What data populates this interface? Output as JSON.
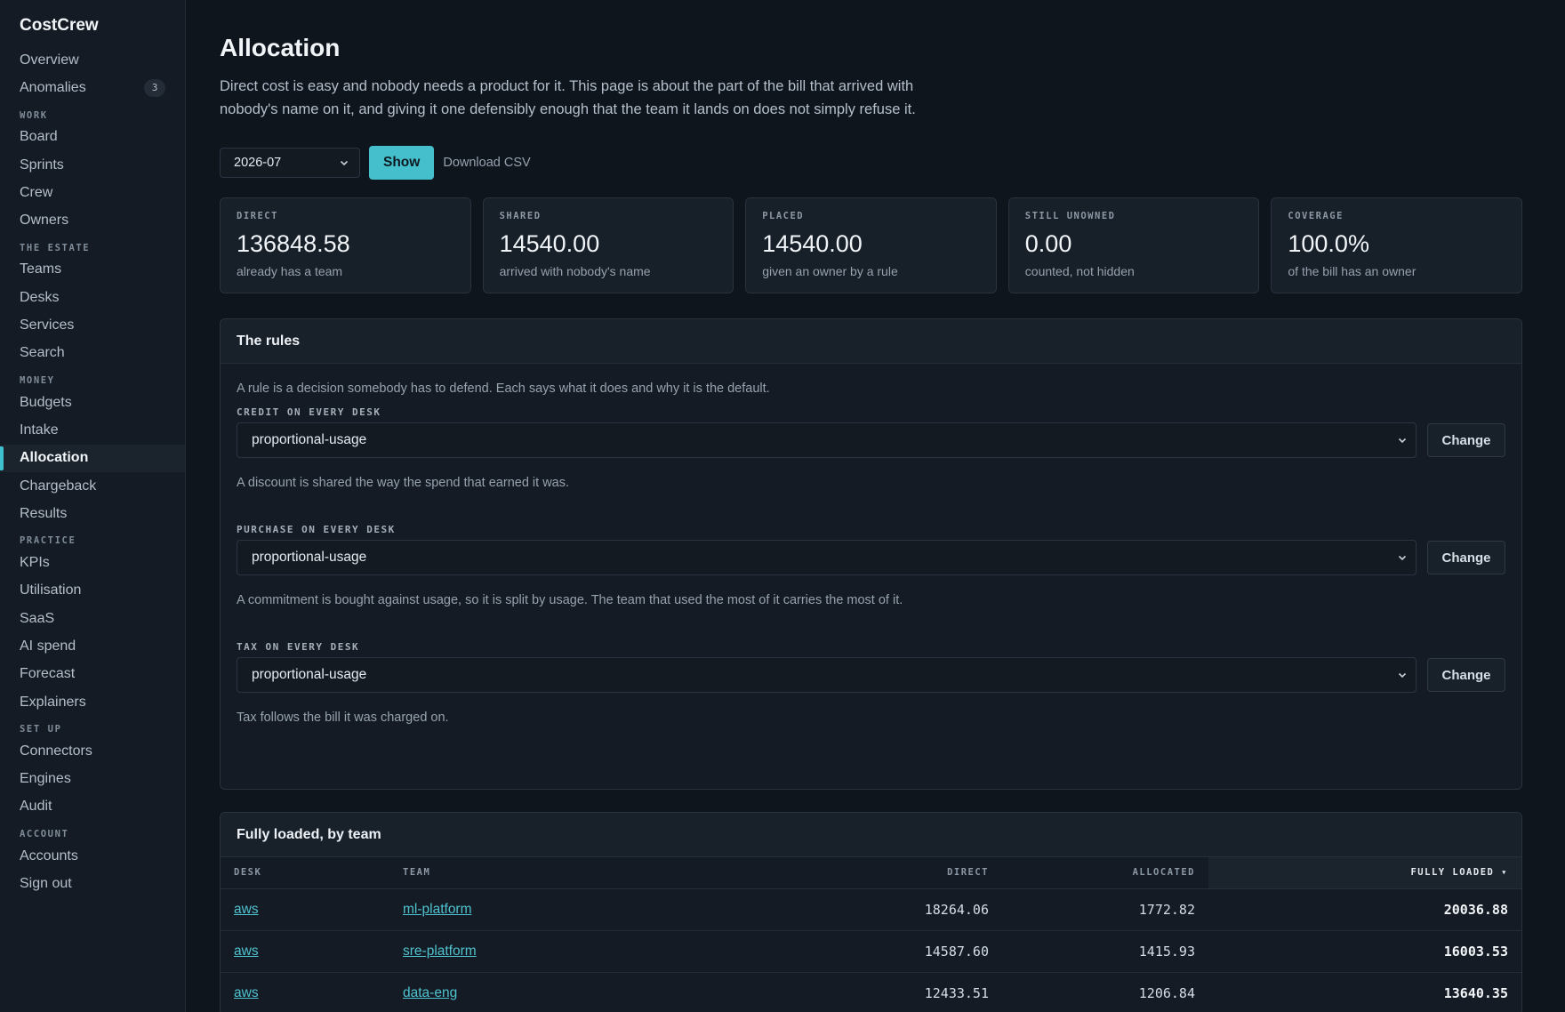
{
  "app": {
    "name": "CostCrew"
  },
  "sidebar": {
    "items": [
      {
        "type": "item",
        "label": "Overview"
      },
      {
        "type": "item",
        "label": "Anomalies",
        "badge": "3"
      },
      {
        "type": "section",
        "label": "WORK"
      },
      {
        "type": "item",
        "label": "Board"
      },
      {
        "type": "item",
        "label": "Sprints"
      },
      {
        "type": "item",
        "label": "Crew"
      },
      {
        "type": "item",
        "label": "Owners"
      },
      {
        "type": "section",
        "label": "THE ESTATE"
      },
      {
        "type": "item",
        "label": "Teams"
      },
      {
        "type": "item",
        "label": "Desks"
      },
      {
        "type": "item",
        "label": "Services"
      },
      {
        "type": "item",
        "label": "Search"
      },
      {
        "type": "section",
        "label": "MONEY"
      },
      {
        "type": "item",
        "label": "Budgets"
      },
      {
        "type": "item",
        "label": "Intake"
      },
      {
        "type": "item",
        "label": "Allocation",
        "active": true
      },
      {
        "type": "item",
        "label": "Chargeback"
      },
      {
        "type": "item",
        "label": "Results"
      },
      {
        "type": "section",
        "label": "PRACTICE"
      },
      {
        "type": "item",
        "label": "KPIs"
      },
      {
        "type": "item",
        "label": "Utilisation"
      },
      {
        "type": "item",
        "label": "SaaS"
      },
      {
        "type": "item",
        "label": "AI spend"
      },
      {
        "type": "item",
        "label": "Forecast"
      },
      {
        "type": "item",
        "label": "Explainers"
      },
      {
        "type": "section",
        "label": "SET UP"
      },
      {
        "type": "item",
        "label": "Connectors"
      },
      {
        "type": "item",
        "label": "Engines"
      },
      {
        "type": "item",
        "label": "Audit"
      },
      {
        "type": "section",
        "label": "ACCOUNT"
      },
      {
        "type": "item",
        "label": "Accounts"
      },
      {
        "type": "item",
        "label": "Sign out"
      }
    ]
  },
  "page": {
    "title": "Allocation",
    "intro": "Direct cost is easy and nobody needs a product for it. This page is about the part of the bill that arrived with nobody's name on it, and giving it one defensibly enough that the team it lands on does not simply refuse it."
  },
  "toolbar": {
    "month": "2026-07",
    "show_label": "Show",
    "csv_label": "Download CSV"
  },
  "stats": [
    {
      "label": "DIRECT",
      "value": "136848.58",
      "sub": "already has a team"
    },
    {
      "label": "SHARED",
      "value": "14540.00",
      "sub": "arrived with nobody's name"
    },
    {
      "label": "PLACED",
      "value": "14540.00",
      "sub": "given an owner by a rule"
    },
    {
      "label": "STILL UNOWNED",
      "value": "0.00",
      "sub": "counted, not hidden"
    },
    {
      "label": "COVERAGE",
      "value": "100.0%",
      "sub": "of the bill has an owner"
    }
  ],
  "rules": {
    "title": "The rules",
    "note": "A rule is a decision somebody has to defend. Each says what it does and why it is the default.",
    "change_label": "Change",
    "items": [
      {
        "label": "CREDIT ON EVERY DESK",
        "value": "proportional-usage",
        "why": "A discount is shared the way the spend that earned it was."
      },
      {
        "label": "PURCHASE ON EVERY DESK",
        "value": "proportional-usage",
        "why": "A commitment is bought against usage, so it is split by usage. The team that used the most of it carries the most of it."
      },
      {
        "label": "TAX ON EVERY DESK",
        "value": "proportional-usage",
        "why": "Tax follows the bill it was charged on."
      }
    ]
  },
  "table": {
    "title": "Fully loaded, by team",
    "columns": [
      "DESK",
      "TEAM",
      "DIRECT",
      "ALLOCATED",
      "FULLY LOADED ▾"
    ],
    "rows": [
      {
        "desk": "aws",
        "team": "ml-platform",
        "direct": "18264.06",
        "allocated": "1772.82",
        "loaded": "20036.88"
      },
      {
        "desk": "aws",
        "team": "sre-platform",
        "direct": "14587.60",
        "allocated": "1415.93",
        "loaded": "16003.53"
      },
      {
        "desk": "aws",
        "team": "data-eng",
        "direct": "12433.51",
        "allocated": "1206.84",
        "loaded": "13640.35"
      }
    ]
  },
  "colors": {
    "accent": "#45bfcb",
    "link": "#4fc3cf",
    "background": "#0f151d",
    "sidebar": "#141b24"
  }
}
